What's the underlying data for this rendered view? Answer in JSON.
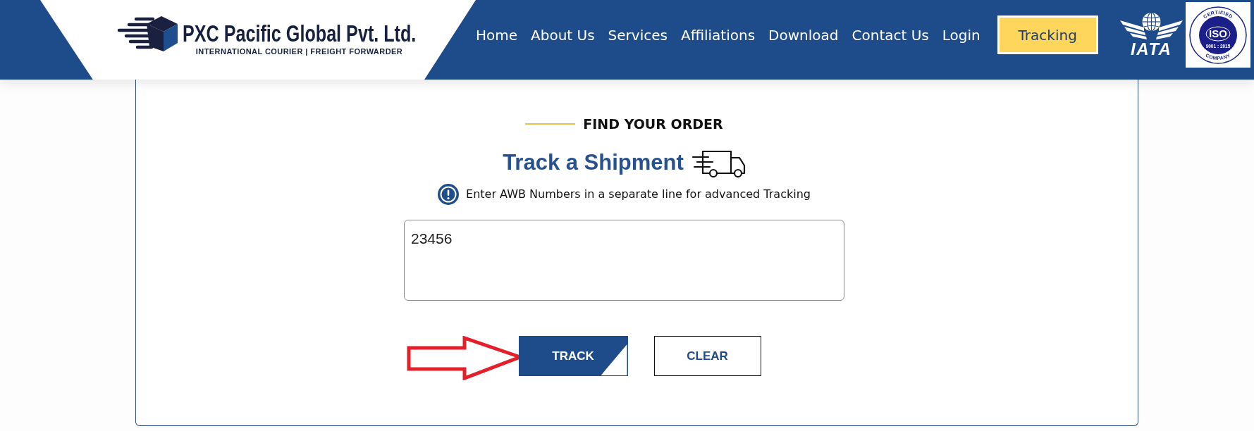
{
  "header": {
    "logo": {
      "name": "PXC Pacific Global Pvt. Ltd.",
      "tagline": "INTERNATIONAL COURIER | FREIGHT FORWARDER"
    },
    "nav": [
      "Home",
      "About Us",
      "Services",
      "Affiliations",
      "Download",
      "Contact Us",
      "Login"
    ],
    "tracking_button": "Tracking",
    "accreditations": [
      {
        "kind": "iata",
        "label": "IATA"
      },
      {
        "kind": "iso",
        "top_text": "CERTIFIED",
        "title": "ISO",
        "standard": "9001 : 2015",
        "bottom_text": "COMPANY"
      }
    ]
  },
  "tracking_form": {
    "eyebrow": "FIND YOUR ORDER",
    "title": "Track a Shipment",
    "hint": "Enter AWB Numbers in a separate line for advanced Tracking",
    "awb_numbers": {
      "value": "23456"
    },
    "buttons": [
      {
        "kind": "primary",
        "label": "TRACK"
      },
      {
        "kind": "secondary",
        "label": "CLEAR"
      }
    ]
  }
}
